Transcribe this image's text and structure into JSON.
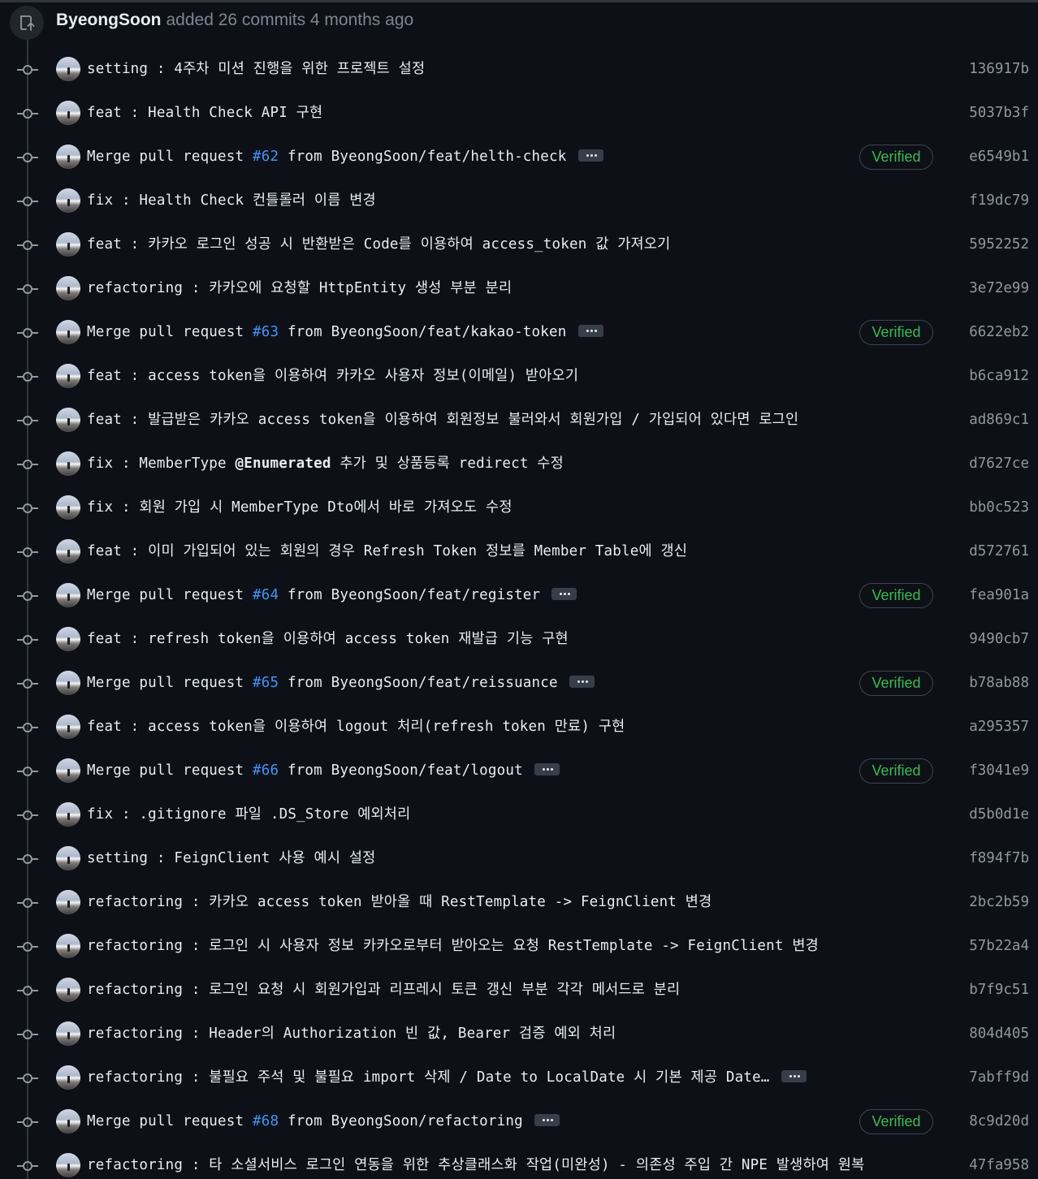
{
  "header": {
    "author": "ByeongSoon",
    "action": "added 26 commits 4 months ago"
  },
  "colors": {
    "background": "#0d1117",
    "link": "#4493f8",
    "verified": "#3fb950",
    "sha": "#9198a1"
  },
  "commits": [
    {
      "message": "setting : 4주차 미션 진행을 위한 프로젝트 설정",
      "sha": "136917b",
      "verified": false
    },
    {
      "message": "feat : Health Check API 구현",
      "sha": "5037b3f",
      "verified": false
    },
    {
      "prefix": "Merge pull request ",
      "pr": "#62",
      "suffix": " from ByeongSoon/feat/helth-check",
      "sha": "e6549b1",
      "verified": true,
      "verified_label": "Verified",
      "more": true
    },
    {
      "message": "fix : Health Check 컨틀롤러 이름 변경",
      "sha": "f19dc79",
      "verified": false
    },
    {
      "message": "feat : 카카오 로그인 성공 시 반환받은 Code를 이용하여 access_token 값 가져오기",
      "sha": "5952252",
      "verified": false
    },
    {
      "message": "refactoring : 카카오에 요청할 HttpEntity 생성 부분 분리",
      "sha": "3e72e99",
      "verified": false
    },
    {
      "prefix": "Merge pull request ",
      "pr": "#63",
      "suffix": " from ByeongSoon/feat/kakao-token",
      "sha": "6622eb2",
      "verified": true,
      "verified_label": "Verified",
      "more": true
    },
    {
      "message": "feat : access token을 이용하여 카카오 사용자 정보(이메일) 받아오기",
      "sha": "b6ca912",
      "verified": false
    },
    {
      "message": "feat : 발급받은 카카오 access token을 이용하여 회원정보 불러와서 회원가입 / 가입되어 있다면 로그인",
      "sha": "ad869c1",
      "verified": false
    },
    {
      "prefix": "fix : MemberType ",
      "bold": "@Enumerated",
      "suffix": " 추가 및 상품등록 redirect 수정",
      "sha": "d7627ce",
      "verified": false
    },
    {
      "message": "fix : 회원 가입 시 MemberType Dto에서 바로 가져오도 수정",
      "sha": "bb0c523",
      "verified": false
    },
    {
      "message": "feat : 이미 가입되어 있는 회원의 경우 Refresh Token 정보를 Member Table에 갱신",
      "sha": "d572761",
      "verified": false
    },
    {
      "prefix": "Merge pull request ",
      "pr": "#64",
      "suffix": " from ByeongSoon/feat/register",
      "sha": "fea901a",
      "verified": true,
      "verified_label": "Verified",
      "more": true
    },
    {
      "message": "feat : refresh token을 이용하여 access token 재발급 기능 구현",
      "sha": "9490cb7",
      "verified": false
    },
    {
      "prefix": "Merge pull request ",
      "pr": "#65",
      "suffix": " from ByeongSoon/feat/reissuance",
      "sha": "b78ab88",
      "verified": true,
      "verified_label": "Verified",
      "more": true
    },
    {
      "message": "feat : access token을 이용하여 logout 처리(refresh token 만료) 구현",
      "sha": "a295357",
      "verified": false
    },
    {
      "prefix": "Merge pull request ",
      "pr": "#66",
      "suffix": " from ByeongSoon/feat/logout",
      "sha": "f3041e9",
      "verified": true,
      "verified_label": "Verified",
      "more": true
    },
    {
      "message": "fix : .gitignore 파일 .DS_Store 예외처리",
      "sha": "d5b0d1e",
      "verified": false
    },
    {
      "message": "setting : FeignClient 사용 예시 설정",
      "sha": "f894f7b",
      "verified": false
    },
    {
      "message": "refactoring : 카카오 access token 받아올 때 RestTemplate -> FeignClient 변경",
      "sha": "2bc2b59",
      "verified": false
    },
    {
      "message": "refactoring : 로그인 시 사용자 정보 카카오로부터 받아오는 요청 RestTemplate -> FeignClient 변경",
      "sha": "57b22a4",
      "verified": false
    },
    {
      "message": "refactoring : 로그인 요청 시 회원가입과 리프레시 토큰 갱신 부분 각각 메서드로 분리",
      "sha": "b7f9c51",
      "verified": false
    },
    {
      "message": "refactoring : Header의 Authorization 빈 값, Bearer 검증 예외 처리",
      "sha": "804d405",
      "verified": false
    },
    {
      "message": "refactoring : 불필요 주석 및 불필요 import 삭제 / Date to LocalDate 시 기본 제공 Date…",
      "sha": "7abff9d",
      "verified": false,
      "more": true
    },
    {
      "prefix": "Merge pull request ",
      "pr": "#68",
      "suffix": " from ByeongSoon/refactoring",
      "sha": "8c9d20d",
      "verified": true,
      "verified_label": "Verified",
      "more": true
    },
    {
      "message": "refactoring : 타 소셜서비스 로그인 연동을 위한 추상클래스화 작업(미완성) - 의존성 주입 간 NPE 발생하여 원복",
      "sha": "47fa958",
      "verified": false
    }
  ]
}
